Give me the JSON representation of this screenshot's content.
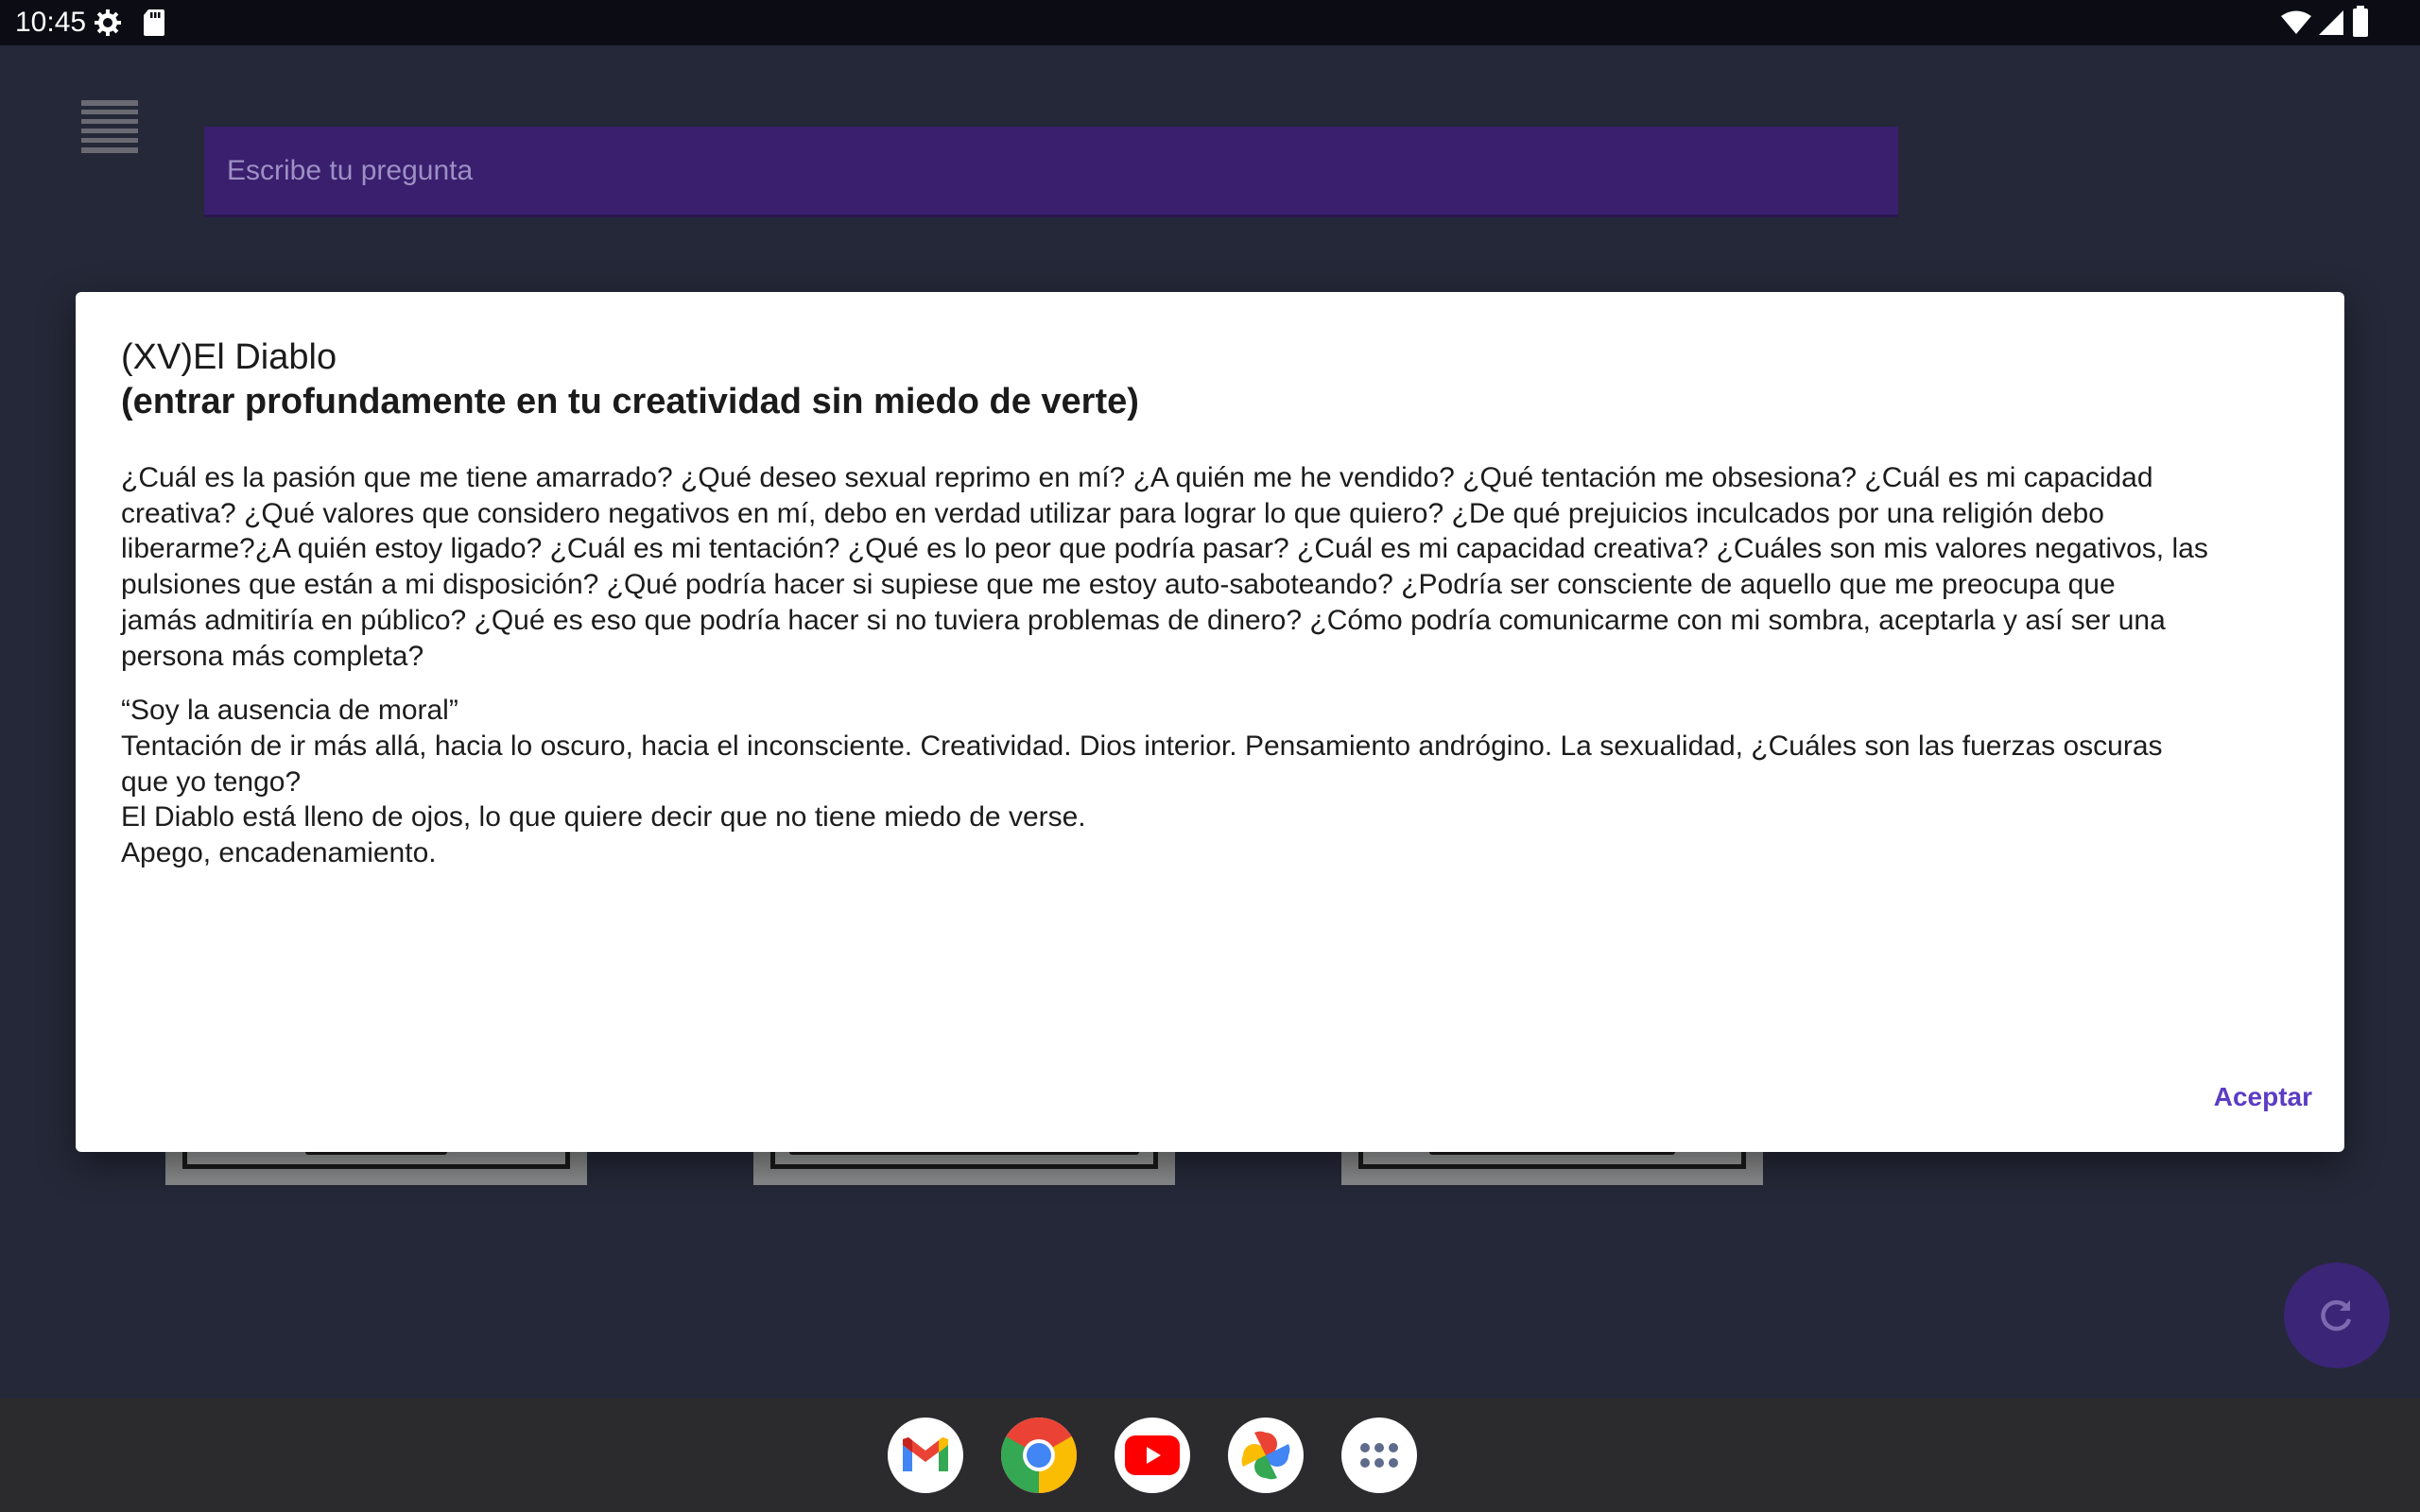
{
  "status_bar": {
    "time": "10:45",
    "icons": [
      "settings-icon",
      "sd-card-icon",
      "wifi-icon",
      "signal-icon",
      "battery-icon"
    ]
  },
  "app": {
    "menu_icon": "hamburger-menu-icon",
    "search": {
      "placeholder": "Escribe tu pregunta",
      "value": ""
    },
    "refresh_icon": "refresh-icon",
    "colors": {
      "accent": "#5b3cc4",
      "search_bg": "#3a1f6e",
      "background": "#252838"
    }
  },
  "dialog": {
    "title_line1": "(XV)El Diablo",
    "title_line2": "(entrar profundamente en tu creatividad sin miedo de verte)",
    "paragraph1_lines": [
      "¿Cuál es la pasión que me tiene amarrado? ¿Qué deseo sexual reprimo en mí? ¿A quién me he vendido? ¿Qué tentación me obsesiona? ¿Cuál es mi capacidad",
      "creativa? ¿Qué valores que considero negativos en mí, debo en verdad utilizar para lograr lo que quiero? ¿De qué prejuicios inculcados por una religión debo",
      "liberarme?¿A quién estoy ligado? ¿Cuál es mi tentación? ¿Qué es lo peor que podría pasar? ¿Cuál es mi capacidad creativa? ¿Cuáles son mis valores negativos, las",
      "pulsiones que están a mi disposición? ¿Qué podría hacer si supiese que me estoy auto-saboteando? ¿Podría ser consciente de aquello que me preocupa que",
      "jamás admitiría en público? ¿Qué es eso que podría hacer si no tuviera problemas de dinero? ¿Cómo podría comunicarme con mi sombra, aceptarla y así ser una",
      "persona más completa?"
    ],
    "paragraph2_lines": [
      "“Soy la ausencia de moral”",
      "Tentación de ir más allá, hacia lo oscuro, hacia el inconsciente. Creatividad. Dios interior. Pensamiento andrógino. La sexualidad, ¿Cuáles son las fuerzas oscuras",
      "que yo tengo?",
      "El Diablo está lleno de ojos, lo que quiere decir que no tiene miedo de verse.",
      "Apego, encadenamiento."
    ],
    "accept_label": "Aceptar"
  },
  "dock": {
    "apps": [
      {
        "name": "Gmail",
        "icon": "gmail-icon"
      },
      {
        "name": "Chrome",
        "icon": "chrome-icon"
      },
      {
        "name": "YouTube",
        "icon": "youtube-icon"
      },
      {
        "name": "Photos",
        "icon": "photos-icon"
      },
      {
        "name": "App drawer",
        "icon": "app-drawer-icon"
      }
    ]
  }
}
